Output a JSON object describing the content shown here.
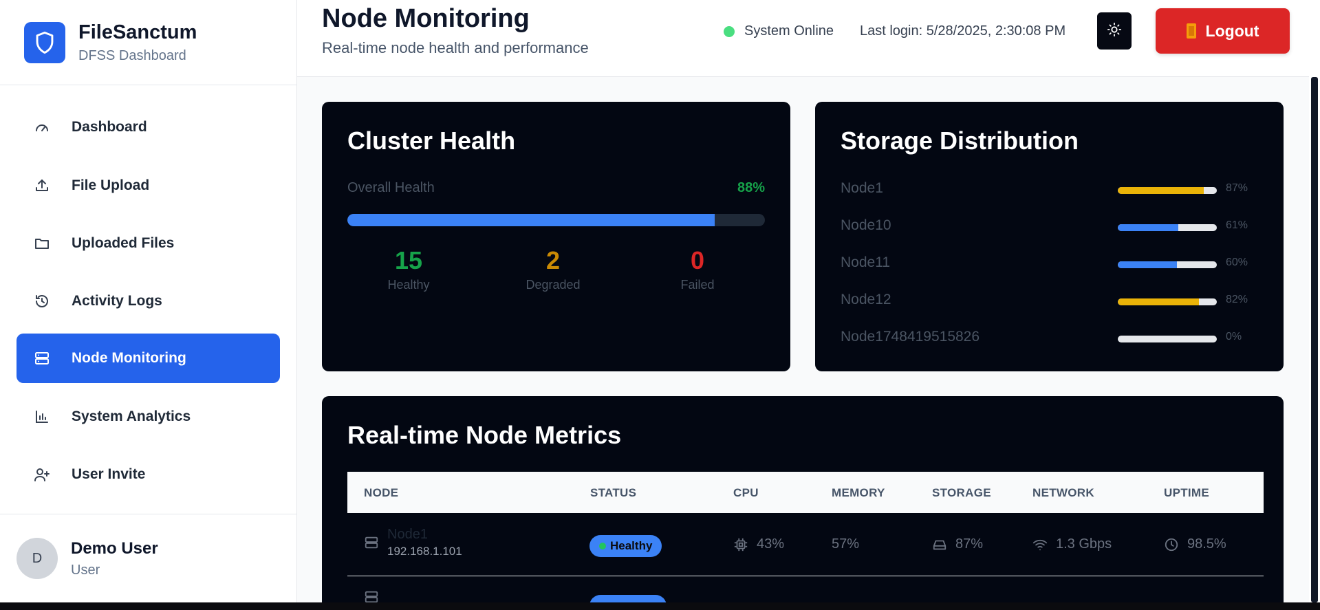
{
  "brand": {
    "title": "FileSanctum",
    "subtitle": "DFSS Dashboard"
  },
  "nav": [
    {
      "label": "Dashboard",
      "icon": "gauge-icon"
    },
    {
      "label": "File Upload",
      "icon": "upload-icon"
    },
    {
      "label": "Uploaded Files",
      "icon": "folder-icon"
    },
    {
      "label": "Activity Logs",
      "icon": "history-icon"
    },
    {
      "label": "Node Monitoring",
      "icon": "server-icon",
      "active": true
    },
    {
      "label": "System Analytics",
      "icon": "bar-chart-icon"
    },
    {
      "label": "User Invite",
      "icon": "user-plus-icon"
    }
  ],
  "user": {
    "initial": "D",
    "name": "Demo User",
    "role": "User"
  },
  "header": {
    "title": "Node Monitoring",
    "subtitle": "Real-time node health and performance",
    "status": "System Online",
    "last_login": "Last login: 5/28/2025, 2:30:08 PM",
    "logout": "Logout"
  },
  "cluster": {
    "title": "Cluster Health",
    "overall_label": "Overall Health",
    "overall_pct": "88%",
    "overall_value": 88,
    "healthy": {
      "value": "15",
      "label": "Healthy"
    },
    "degraded": {
      "value": "2",
      "label": "Degraded"
    },
    "failed": {
      "value": "0",
      "label": "Failed"
    }
  },
  "storage": {
    "title": "Storage Distribution",
    "nodes": [
      {
        "name": "Node1",
        "pct": "87%",
        "value": 87,
        "color": "#eab308"
      },
      {
        "name": "Node10",
        "pct": "61%",
        "value": 61,
        "color": "#3b82f6"
      },
      {
        "name": "Node11",
        "pct": "60%",
        "value": 60,
        "color": "#3b82f6"
      },
      {
        "name": "Node12",
        "pct": "82%",
        "value": 82,
        "color": "#eab308"
      },
      {
        "name": "Node1748419515826",
        "pct": "0%",
        "value": 0,
        "color": "#3b82f6"
      }
    ]
  },
  "metrics": {
    "title": "Real-time Node Metrics",
    "columns": [
      "NODE",
      "STATUS",
      "CPU",
      "MEMORY",
      "STORAGE",
      "NETWORK",
      "UPTIME"
    ],
    "rows": [
      {
        "node": "Node1",
        "ip": "192.168.1.101",
        "status": "Healthy",
        "cpu": "43%",
        "memory": "57%",
        "storage": "87%",
        "network": "1.3 Gbps",
        "uptime": "98.5%"
      }
    ]
  },
  "colors": {
    "accent": "#2563eb",
    "healthy": "#16a34a",
    "degraded": "#ca8a04",
    "failed": "#dc2626",
    "logout": "#dc2626"
  }
}
